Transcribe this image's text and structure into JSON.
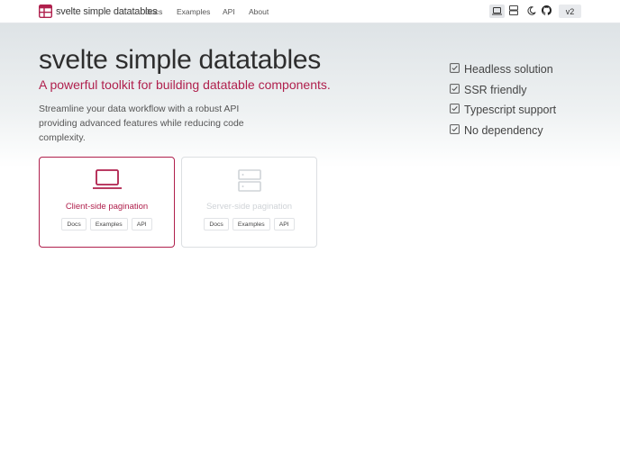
{
  "brand": {
    "title": "svelte simple datatables",
    "icon": "table-icon",
    "color": "#b0204d"
  },
  "nav": [
    {
      "label": "Docs"
    },
    {
      "label": "Examples"
    },
    {
      "label": "API"
    },
    {
      "label": "About"
    }
  ],
  "toolbar": {
    "icons": [
      "laptop-icon",
      "server-icon",
      "moon-icon",
      "github-icon"
    ],
    "version": "v2"
  },
  "hero": {
    "title": "svelte simple datatables",
    "subtitle": "A powerful toolkit for building datatable components.",
    "description": "Streamline your data workflow with a robust API providing advanced features while reducing code complexity."
  },
  "features": [
    {
      "label": "Headless solution"
    },
    {
      "label": "SSR friendly"
    },
    {
      "label": "Typescript support"
    },
    {
      "label": "No dependency"
    }
  ],
  "cards": [
    {
      "title": "Client-side pagination",
      "icon": "laptop-icon",
      "links": [
        "Docs",
        "Examples",
        "API"
      ]
    },
    {
      "title": "Server-side pagination",
      "icon": "server-icon",
      "links": [
        "Docs",
        "Examples",
        "API"
      ]
    }
  ],
  "colors": {
    "accent": "#b0204d",
    "muted": "#cfd3d7"
  }
}
